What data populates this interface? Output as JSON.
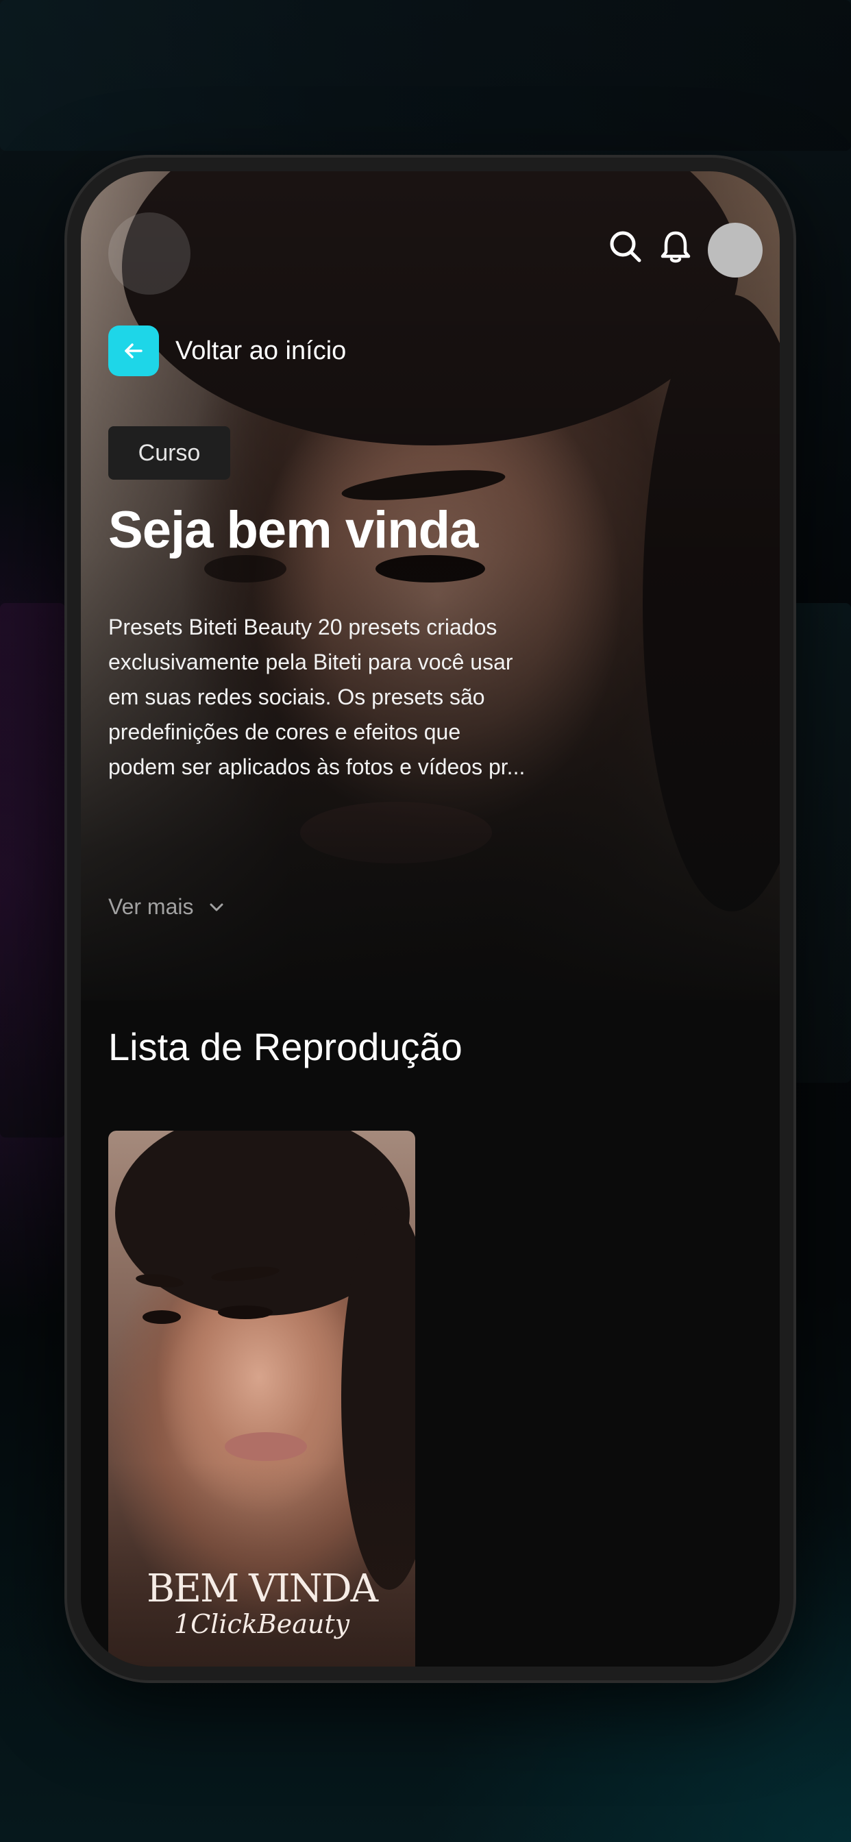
{
  "header": {
    "search_icon": "search-icon",
    "notification_icon": "bell-icon",
    "avatar": "profile-avatar"
  },
  "nav": {
    "back_label": "Voltar ao início",
    "back_icon": "arrow-left-icon"
  },
  "course": {
    "badge": "Curso",
    "title": "Seja bem vinda",
    "description": "Presets Biteti Beauty 20 presets criados exclusivamente pela Biteti para você usar em suas redes sociais. Os presets são predefinições de cores e efeitos que podem ser aplicados às fotos e vídeos pr...",
    "more_label": "Ver mais"
  },
  "playlist": {
    "title": "Lista de Reprodução",
    "items": [
      {
        "overlay_line1": "BEM VINDA",
        "overlay_line2": "1ClickBeauty"
      }
    ]
  },
  "colors": {
    "accent": "#1ed6e8",
    "background": "#0b0b0b",
    "badge_bg": "#1f1f1f"
  }
}
